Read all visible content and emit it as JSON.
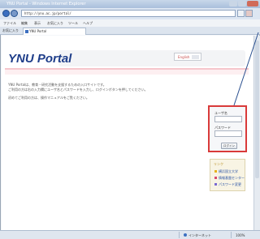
{
  "browser": {
    "title": "YNU Portal - Windows Internet Explorer",
    "address": "http://ynu.ac.jp/portal/",
    "menu": [
      "ファイル",
      "編集",
      "表示",
      "お気に入り",
      "ツール",
      "ヘルプ"
    ],
    "favorites_label": "お気に入り",
    "tab_label": "YNU Portal",
    "status_zone": "インターネット",
    "status_zoom": "100%"
  },
  "page": {
    "logo": "YNU Portal",
    "language_label": "English",
    "notes": [
      "YNU Portalは、教育・研究活動を支援するための入口サイトです。",
      "ご利用の方は右の入力欄にユーザ名とパスワードを入力し、ログインボタンを押してください。",
      "初めてご利用の方は、操作マニュアルをご覧ください。"
    ],
    "login": {
      "username_label": "ユーザ名",
      "password_label": "パスワード",
      "login_button": "ログイン"
    },
    "links": {
      "title": "リンク",
      "items": [
        "横浜国立大学",
        "情報基盤センター",
        "パスワード変更"
      ]
    }
  },
  "colors": {
    "login_highlight": "#d93a3a",
    "logo": "#1f3e8a"
  }
}
